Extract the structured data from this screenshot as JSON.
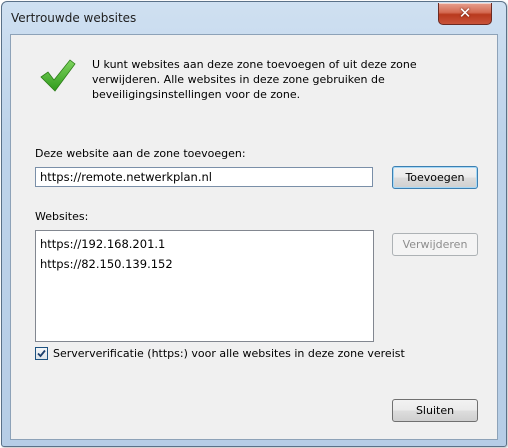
{
  "window": {
    "title": "Vertrouwde websites",
    "close_glyph": "✕"
  },
  "intro": {
    "text": "U kunt websites aan deze zone toevoegen of uit deze zone verwijderen. Alle websites in deze zone gebruiken de beveiligingsinstellingen voor de zone."
  },
  "add": {
    "label": "Deze website aan de zone toevoegen:",
    "value": "https://remote.netwerkplan.nl",
    "button_label": "Toevoegen"
  },
  "websites": {
    "label": "Websites:",
    "items": [
      "https://192.168.201.1",
      "https://82.150.139.152"
    ],
    "remove_button_label": "Verwijderen"
  },
  "https_requirement": {
    "label": "Serververificatie (https:) voor alle websites in deze zone vereist",
    "checked": true
  },
  "footer": {
    "close_label": "Sluiten"
  },
  "icons": {
    "intro": "checkmark-icon",
    "title_close": "close-icon"
  },
  "colors": {
    "checkmark": "#3fae2a",
    "close_button": "#c9533a",
    "default_button_border": "#3c7fb1"
  }
}
